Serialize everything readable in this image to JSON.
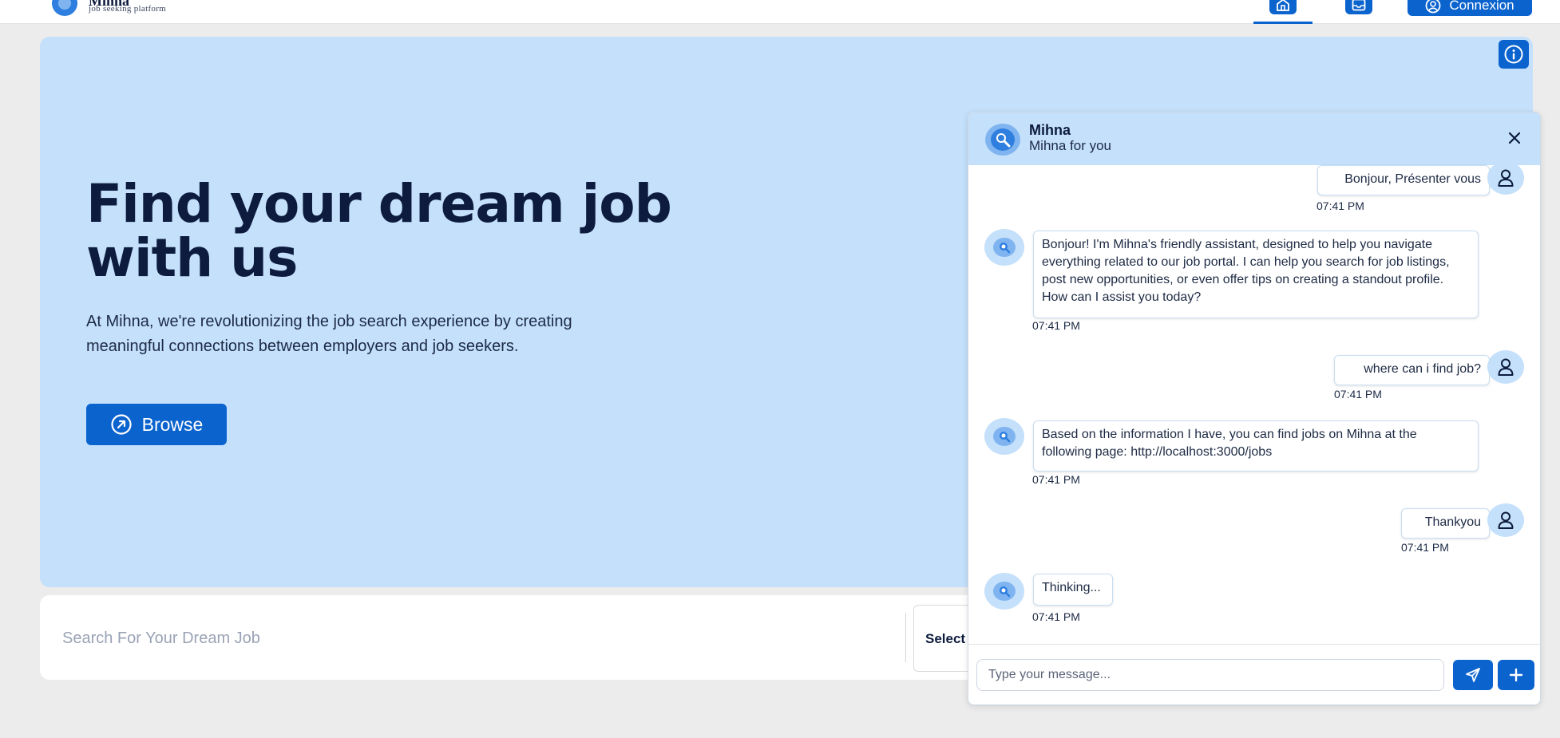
{
  "brand": {
    "name": "Mihna",
    "tagline": "job seeking platform",
    "logo_icon": "mihna-logo-icon"
  },
  "nav": {
    "home_icon": "home-icon",
    "inbox_icon": "inbox-icon",
    "login_label": "Connexion",
    "login_icon": "user-circle-icon"
  },
  "hero": {
    "title": "Find your dream job with us",
    "description": "At Mihna, we're revolutionizing the job search experience by creating meaningful connections between employers and job seekers.",
    "browse_label": "Browse",
    "browse_icon": "arrow-up-right-circle-icon",
    "info_icon": "info-icon"
  },
  "search": {
    "placeholder": "Search For Your Dream Job",
    "select_label": "Select a"
  },
  "chat": {
    "title": "Mihna",
    "subtitle": "Mihna for you",
    "close_icon": "close-icon",
    "messages": [
      {
        "sender": "user",
        "text": "Bonjour, Présenter vous",
        "time": "07:41 PM"
      },
      {
        "sender": "bot",
        "text": "Bonjour! I'm Mihna's friendly assistant, designed to help you navigate everything related to our job portal. I can help you search for job listings, post new opportunities, or even offer tips on creating a standout profile. How can I assist you today?",
        "time": "07:41 PM"
      },
      {
        "sender": "user",
        "text": "where can i find job?",
        "time": "07:41 PM"
      },
      {
        "sender": "bot",
        "text": "Based on the information I have, you can find jobs on Mihna at the following page: http://localhost:3000/jobs",
        "time": "07:41 PM"
      },
      {
        "sender": "user",
        "text": "Thankyou",
        "time": "07:41 PM"
      },
      {
        "sender": "bot",
        "text": "Thinking...",
        "time": "07:41 PM"
      }
    ],
    "input_placeholder": "Type your message...",
    "send_icon": "send-icon",
    "add_icon": "plus-icon"
  },
  "colors": {
    "primary": "#0b63ce",
    "hero_bg": "#c4e0fb",
    "page_bg": "#ececec",
    "heading": "#0d1b3e"
  }
}
